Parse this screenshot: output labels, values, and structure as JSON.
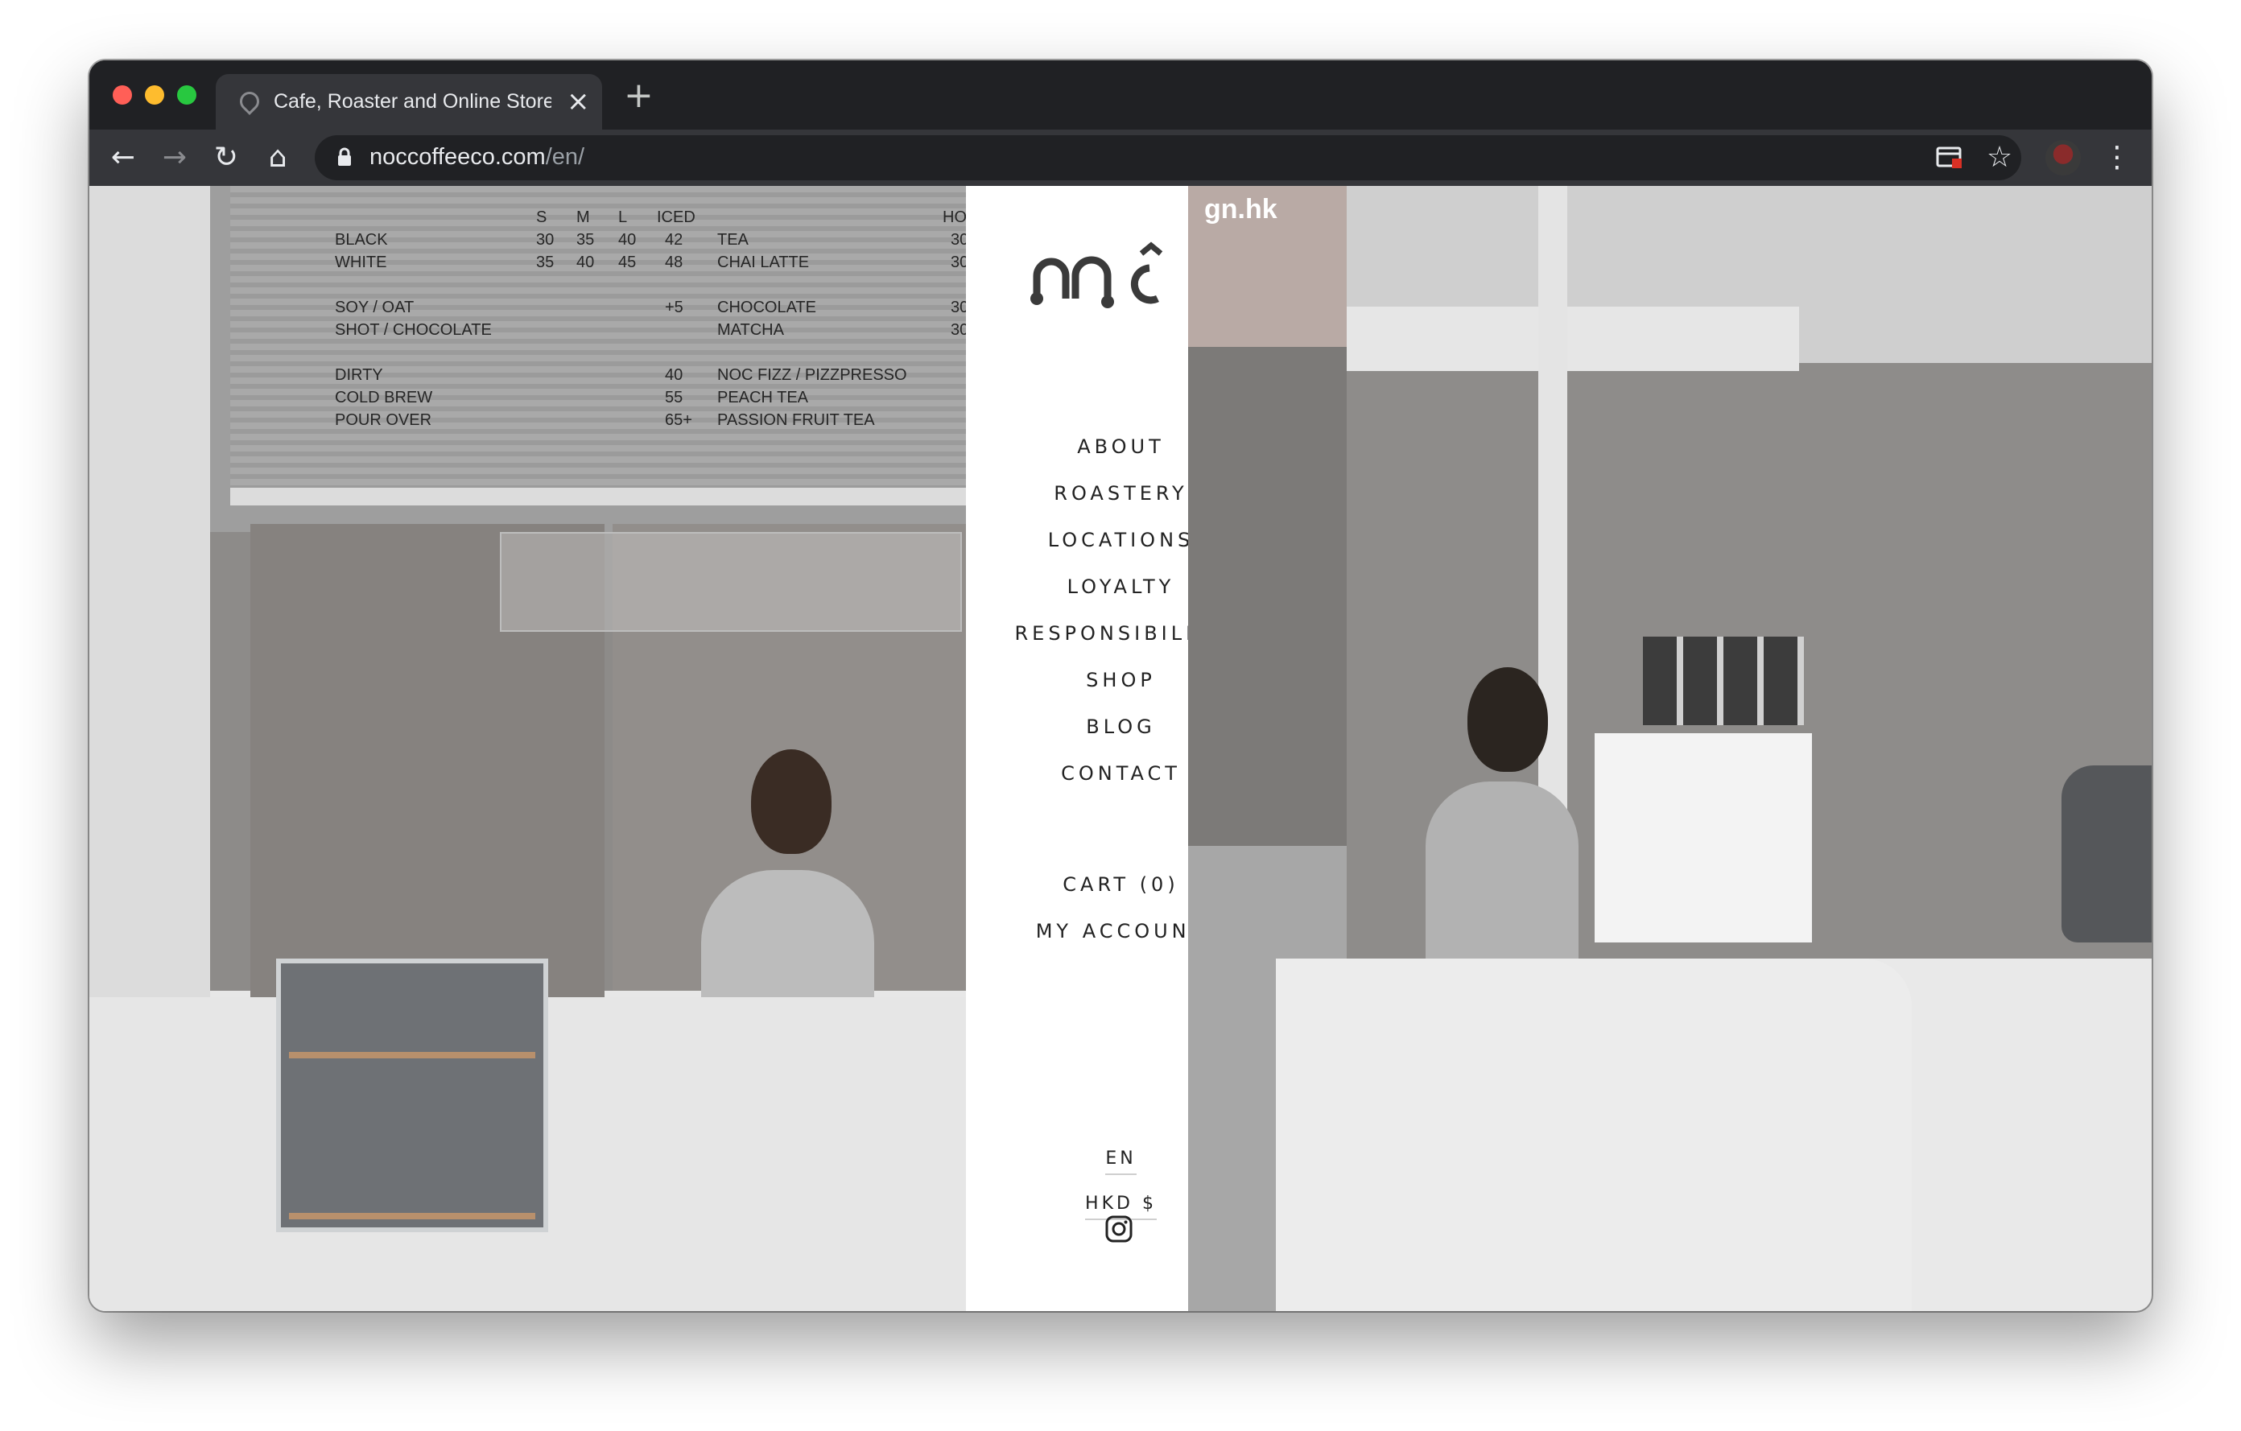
{
  "browser": {
    "tab": {
      "title": "Cafe, Roaster and Online Store",
      "close_icon": "×"
    },
    "new_tab_icon": "+",
    "toolbar": {
      "back_icon": "←",
      "forward_icon": "→",
      "reload_icon": "↻",
      "home_icon": "⌂",
      "star_icon": "☆",
      "menu_icon": "⋮"
    },
    "url": {
      "domain": "noccoffeeco.com",
      "path": "/en/"
    }
  },
  "menu_board": {
    "left_header": [
      "S",
      "M",
      "L",
      "ICED"
    ],
    "left_rows": [
      [
        "BLACK",
        "30",
        "35",
        "40",
        "42"
      ],
      [
        "WHITE",
        "35",
        "40",
        "45",
        "48"
      ],
      [
        "SOY / OAT",
        "",
        "",
        "",
        "+5"
      ],
      [
        "SHOT / CHOCOLATE",
        "",
        "",
        "",
        ""
      ],
      [
        "DIRTY",
        "",
        "",
        "",
        "40"
      ],
      [
        "COLD BREW",
        "",
        "",
        "",
        "55"
      ],
      [
        "POUR OVER",
        "",
        "",
        "",
        "65+"
      ]
    ],
    "right_header": "HOT",
    "right_rows": [
      [
        "TEA",
        "30"
      ],
      [
        "CHAI LATTE",
        "30"
      ],
      [
        "CHOCOLATE",
        "30"
      ],
      [
        "MATCHA",
        "30"
      ],
      [
        "NOC FIZZ / PIZZPRESSO",
        ""
      ],
      [
        "PEACH TEA",
        ""
      ],
      [
        "PASSION FRUIT TEA",
        ""
      ]
    ]
  },
  "sidebar": {
    "logo_alt": "noc.",
    "nav": [
      "ABOUT",
      "ROASTERY",
      "LOCATIONS",
      "LOYALTY",
      "RESPONSIBILITY",
      "SHOP",
      "BLOG",
      "CONTACT"
    ],
    "cart": "CART (0)",
    "account": "MY ACCOUNT",
    "language": "EN",
    "currency": "HKD $",
    "social_icon": "instagram-icon"
  },
  "street_sign": "gn.hk"
}
